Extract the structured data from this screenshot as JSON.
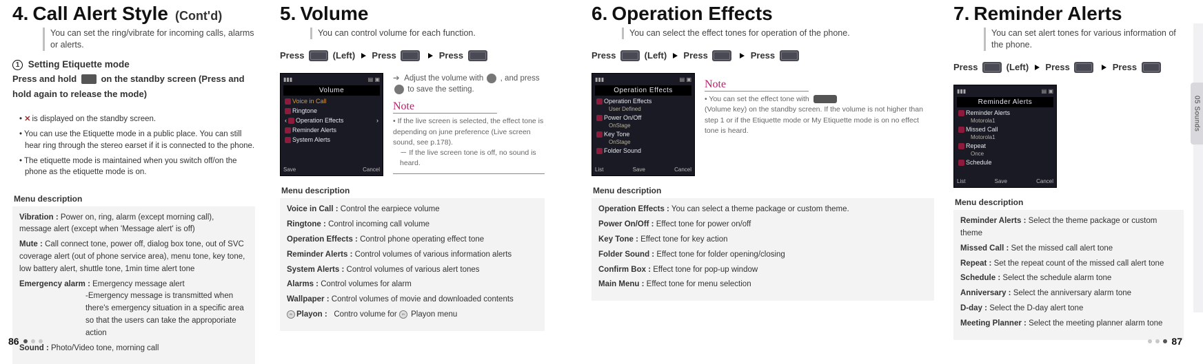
{
  "page": {
    "left_num": "86",
    "right_num": "87",
    "side_tab": "05  Sounds"
  },
  "col1": {
    "num": "4.",
    "title": "Call Alert Style",
    "cont": "(Cont'd)",
    "sub": "You can set the ring/vibrate for incoming calls, alarms or alerts.",
    "circled_label": "1",
    "sub_head": "Setting Etiquette mode",
    "hold_line_a": "Press and hold",
    "hold_line_b": "on the standby screen (Press and hold again to release the mode)",
    "bullets": [
      "is displayed on the standby screen.",
      "You can use the Etiquette mode in a public place. You can still hear ring through the stereo earset if it is connected to the phone.",
      "The etiquette mode is maintained when you switch off/on the phone as the etiquette mode is on."
    ],
    "menu_label": "Menu description",
    "menu": {
      "vibration_t": "Vibration :",
      "vibration_d": "Power on, ring, alarm (except morning call), message alert (except when 'Message alert' is off)",
      "mute_t": "Mute :",
      "mute_d": "Call connect tone, power off, dialog box tone, out of SVC cover­age alert (out of phone service area), menu tone, key tone, low battery alert, shuttle tone, 1min time alert tone",
      "emerg_t": "Emergency alarm :",
      "emerg_d1": "Emergency message alert",
      "emerg_d2": "-Emergency message is transmitted when there's emergency situation in a specific area so that the users can take the approporiate action",
      "sound_t": "Sound :",
      "sound_d": "Photo/Video tone, morning call"
    }
  },
  "col2": {
    "num": "5.",
    "title": "Volume",
    "sub": "You can control volume for each function.",
    "press_a": "Press",
    "press_left": "(Left)",
    "press_b": "Press",
    "press_c": "Press",
    "shot": {
      "title": "Volume",
      "l1": "Voice in Call",
      "l2": "Ringtone",
      "l3": "Operation Effects",
      "l4": "Reminder Alerts",
      "l5": "System Alerts",
      "bl": "Save",
      "br": "Cancel"
    },
    "adjust": "Adjust the volume with",
    "adjust_tail": ", and press",
    "adjust_end": "to save the setting.",
    "note_head": "Note",
    "note_l1": "If the live screen is selected, the effect tone is depending on june preference (Live screen sound, see p.178).",
    "note_l2": "－ If the live screen tone is off, no sound is heard.",
    "menu_label": "Menu description",
    "menu": {
      "voice_t": "Voice in Call :",
      "voice_d": "Control the earpiece volume",
      "ring_t": "Ringtone :",
      "ring_d": "Control incoming call volume",
      "opfx_t": "Operation Effects :",
      "opfx_d": "Control phone operating effect tone",
      "rem_t": "Reminder Alerts :",
      "rem_d": "Control volumes of various information alerts",
      "sys_t": "System Alerts :",
      "sys_d": "Control volumes of various alert tones",
      "alm_t": "Alarms :",
      "alm_d": "Control volumes for alarm",
      "wall_t": "Wallpaper :",
      "wall_d": "Control volumes of movie and downloaded contents",
      "play_t": "Playon :",
      "play_d": "Contro volume for",
      "play_tail": "Playon menu"
    }
  },
  "col3": {
    "num": "6.",
    "title": "Operation Effects",
    "sub": "You can select the effect tones for operation of the phone.",
    "press_a": "Press",
    "press_left": "(Left)",
    "press_b": "Press",
    "press_c": "Press",
    "shot": {
      "title": "Operation Effects",
      "l1": "Operation Effects",
      "l1s": "User Defined",
      "l2": "Power On/Off",
      "l2s": "OnStage",
      "l3": "Key Tone",
      "l3s": "OnStage",
      "l4": "Folder Sound",
      "bl": "List",
      "bm": "Save",
      "br": "Cancel"
    },
    "note_head": "Note",
    "note_l1": "You can set the effect tone with",
    "note_l2": "(Volume key) on the standby screen. If the volume is not higher than step 1 or if the Etiquette mode or My Etiquette mode is on no effect tone is heard.",
    "menu_label": "Menu description",
    "menu": {
      "opfx_t": "Operation Effects :",
      "opfx_d": "You can select a theme package or custom theme.",
      "pow_t": "Power On/Off :",
      "pow_d": "Effect tone for power on/off",
      "key_t": "Key Tone :",
      "key_d": "Effect tone for key action",
      "fold_t": "Folder Sound :",
      "fold_d": "Effect tone for folder opening/closing",
      "conf_t": "Confirm Box :",
      "conf_d": "Effect tone for pop-up window",
      "main_t": "Main Menu :",
      "main_d": "Effect tone for menu selection"
    }
  },
  "col4": {
    "num": "7.",
    "title": "Reminder Alerts",
    "sub": "You can set alert tones for various information of the phone.",
    "press_a": "Press",
    "press_left": "(Left)",
    "press_b": "Press",
    "press_c": "Press",
    "shot": {
      "title": "Reminder Alerts",
      "l1": "Reminder Alerts",
      "l1s": "Motorola1",
      "l2": "Missed Call",
      "l2s": "Motorola1",
      "l3": "Repeat",
      "l3s": "Once",
      "l4": "Schedule",
      "bl": "List",
      "bm": "Save",
      "br": "Cancel"
    },
    "menu_label": "Menu description",
    "menu": {
      "rem_t": "Reminder Alerts :",
      "rem_d": "Select the theme package or custom theme",
      "mc_t": "Missed Call :",
      "mc_d": "Set the missed call alert tone",
      "rep_t": "Repeat :",
      "rep_d": "Set the repeat count of the missed call alert tone",
      "sch_t": "Schedule :",
      "sch_d": "Select the schedule alarm tone",
      "ann_t": "Anniversary :",
      "ann_d": "Select the anniversary alarm tone",
      "dd_t": "D-day :",
      "dd_d": "Select the D-day alert tone",
      "mp_t": "Meeting Planner :",
      "mp_d": "Select the meeting planner alarm tone"
    }
  }
}
